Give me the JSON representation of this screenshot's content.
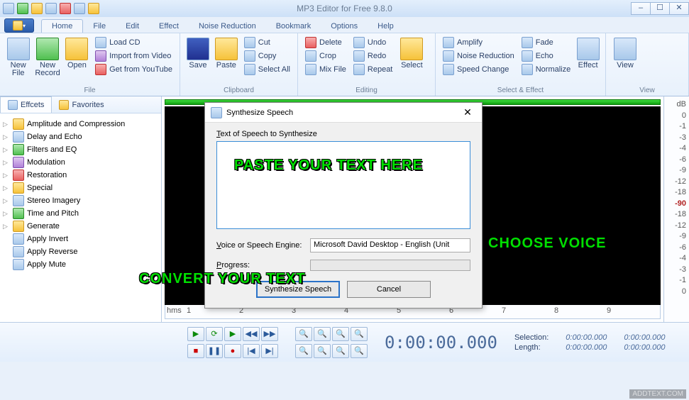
{
  "app": {
    "title": "MP3 Editor for Free 9.8.0"
  },
  "winbtns": {
    "min": "–",
    "max": "☐",
    "close": "✕"
  },
  "tabs": [
    "Home",
    "File",
    "Edit",
    "Effect",
    "Noise Reduction",
    "Bookmark",
    "Options",
    "Help"
  ],
  "active_tab": "Home",
  "ribbon": {
    "file": {
      "label": "File",
      "new_file": "New\nFile",
      "new_record": "New\nRecord",
      "open": "Open",
      "load_cd": "Load CD",
      "import_video": "Import from Video",
      "get_youtube": "Get from YouTube"
    },
    "clipboard": {
      "label": "Clipboard",
      "save": "Save",
      "paste": "Paste",
      "cut": "Cut",
      "copy": "Copy",
      "select_all": "Select All"
    },
    "editing": {
      "label": "Editing",
      "delete": "Delete",
      "crop": "Crop",
      "mix": "Mix File",
      "undo": "Undo",
      "redo": "Redo",
      "repeat": "Repeat",
      "select": "Select"
    },
    "effect": {
      "label": "Select & Effect",
      "amplify": "Amplify",
      "noise": "Noise Reduction",
      "speed": "Speed Change",
      "fade": "Fade",
      "echo": "Echo",
      "normalize": "Normalize",
      "effect_btn": "Effect"
    },
    "view": {
      "label": "View",
      "view_btn": "View"
    }
  },
  "panels": {
    "effects_tab": "Effcets",
    "favorites_tab": "Favorites",
    "tree": [
      {
        "label": "Amplitude and Compression",
        "children": true
      },
      {
        "label": "Delay and Echo",
        "children": true
      },
      {
        "label": "Filters and EQ",
        "children": true
      },
      {
        "label": "Modulation",
        "children": true
      },
      {
        "label": "Restoration",
        "children": true
      },
      {
        "label": "Special",
        "children": true
      },
      {
        "label": "Stereo Imagery",
        "children": true
      },
      {
        "label": "Time and Pitch",
        "children": true
      },
      {
        "label": "Generate",
        "children": true
      },
      {
        "label": "Apply Invert",
        "children": false
      },
      {
        "label": "Apply Reverse",
        "children": false
      },
      {
        "label": "Apply Mute",
        "children": false
      }
    ]
  },
  "db_labels": [
    "dB",
    "0",
    "-1",
    "-3",
    "-4",
    "-6",
    "-9",
    "-12",
    "-18",
    "-90",
    "-18",
    "-12",
    "-9",
    "-6",
    "-4",
    "-3",
    "-1",
    "0"
  ],
  "ruler": {
    "unit": "hms",
    "ticks": [
      "1",
      "2",
      "3",
      "4",
      "5",
      "6",
      "7",
      "8",
      "9"
    ]
  },
  "transport": {
    "timecode": "0:00:00.000"
  },
  "stats": {
    "selection_label": "Selection:",
    "length_label": "Length:",
    "sel_start": "0:00:00.000",
    "sel_end": "0:00:00.000",
    "len_a": "0:00:00.000",
    "len_b": "0:00:00.000"
  },
  "dialog": {
    "title": "Synthesize Speech",
    "text_label_pre": "T",
    "text_label_rest": "ext of Speech to Synthesize",
    "voice_label_pre": "V",
    "voice_label_rest": "oice or Speech Engine:",
    "voice_value": "Microsoft David Desktop - English (Unit",
    "progress_label_pre": "P",
    "progress_label_rest": "rogress:",
    "ok": "Synthesize Speech",
    "cancel": "Cancel"
  },
  "annotations": {
    "paste": "PASTE YOUR TEXT HERE",
    "choose": "CHOOSE VOICE",
    "convert": "CONVERT YOUR TEXT"
  },
  "watermark": "ADDTEXT.COM"
}
